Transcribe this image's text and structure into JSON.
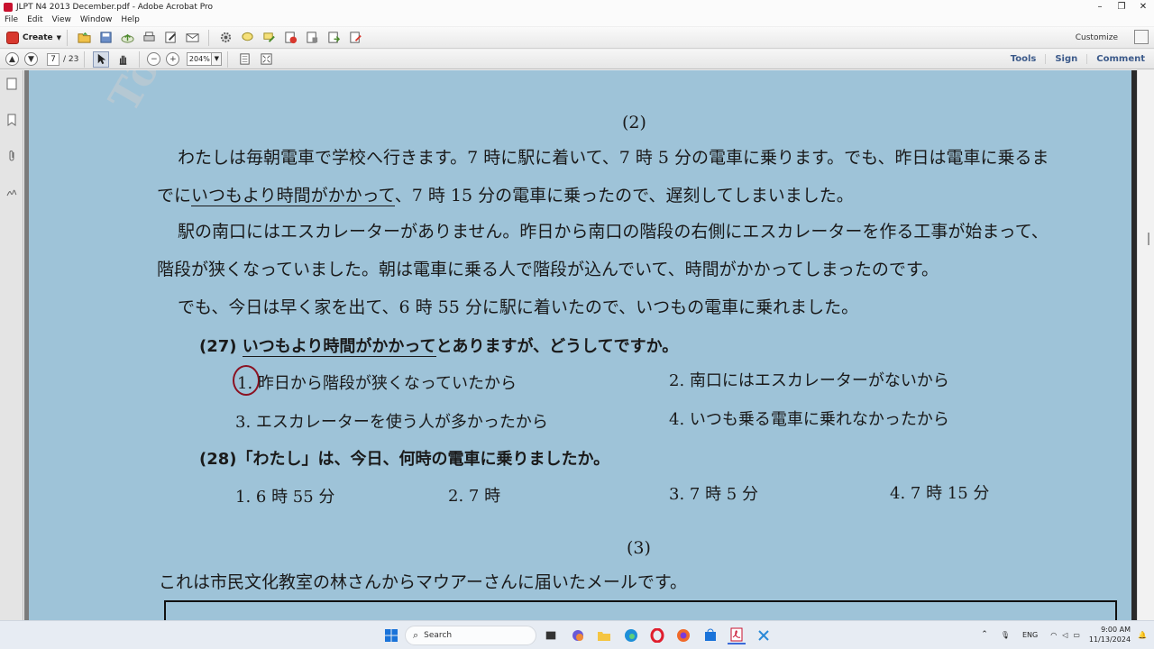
{
  "window": {
    "title": "JLPT N4 2013 December.pdf - Adobe Acrobat Pro",
    "minimize": "–",
    "restore": "❐",
    "close": "✕"
  },
  "menu": [
    "File",
    "Edit",
    "View",
    "Window",
    "Help"
  ],
  "toolbar": {
    "create_label": "Create",
    "customize_label": "Customize"
  },
  "nav": {
    "current_page": "7",
    "total_pages": "/ 23",
    "zoom": "204%"
  },
  "right_links": [
    "Tools",
    "Sign",
    "Comment"
  ],
  "document": {
    "watermark": "Tôi",
    "section2_heading": "(2)",
    "para1_line1": "わたしは毎朝電車で学校へ行きます。7 時に駅に着いて、7 時 5 分の電車に乗ります。でも、昨日は電車に乗るま",
    "para1_line2_pre": "でに",
    "para1_line2_underlined": "いつもより時間がかかって",
    "para1_line2_post": "、7 時 15 分の電車に乗ったので、遅刻してしまいました。",
    "para2_line1": "駅の南口にはエスカレーターがありません。昨日から南口の階段の右側にエスカレーターを作る工事が始まって、",
    "para2_line2": "階段が狭くなっていました。朝は電車に乗る人で階段が込んでいて、時間がかかってしまったのです。",
    "para3": "でも、今日は早く家を出て、6 時 55 分に駅に着いたので、いつもの電車に乗れました。",
    "q27_num": "(27)",
    "q27_underlined": "いつもより時間がかかって",
    "q27_rest": "とありますが、どうしてですか。",
    "q27_choices": [
      "1. 昨日から階段が狭くなっていたから",
      "2. 南口にはエスカレーターがないから",
      "3. エスカレーターを使う人が多かったから",
      "4. いつも乗る電車に乗れなかったから"
    ],
    "q28": "(28)「わたし」は、今日、何時の電車に乗りましたか。",
    "q28_choices": [
      "1. 6 時 55 分",
      "2. 7 時",
      "3. 7 時 5 分",
      "4. 7 時 15 分"
    ],
    "section3_heading": "(3)",
    "section3_intro": "これは市民文化教室の林さんからマウアーさんに届いたメールです。"
  },
  "taskbar": {
    "search_placeholder": "Search",
    "lang": "ENG",
    "time": "9:00 AM",
    "date": "11/13/2024"
  }
}
